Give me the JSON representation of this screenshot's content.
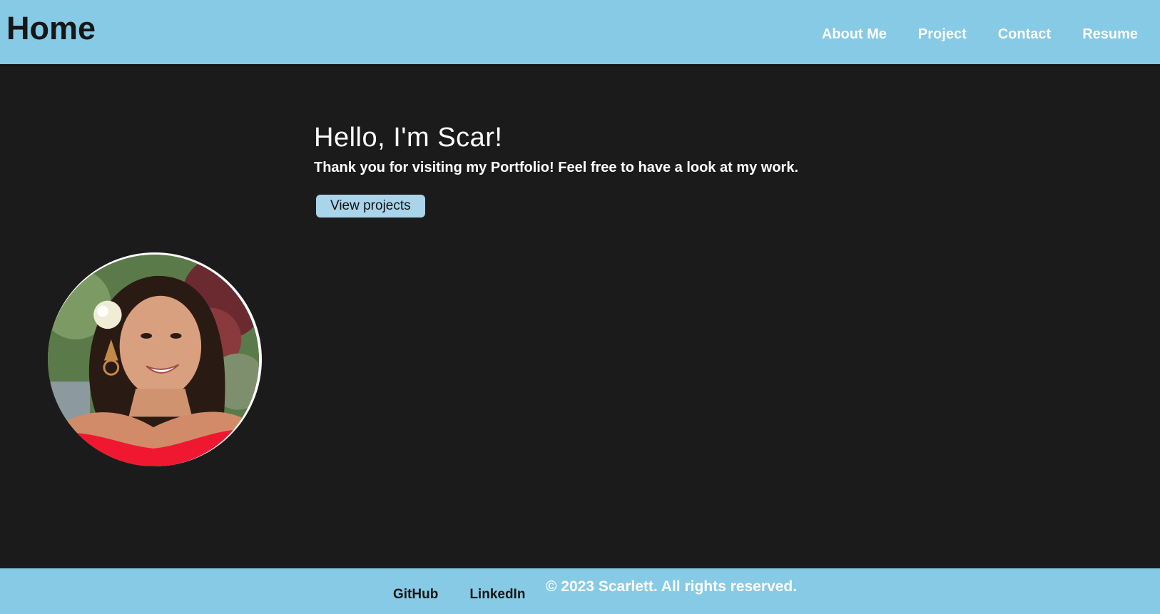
{
  "header": {
    "title": "Home",
    "nav": [
      {
        "label": "About Me"
      },
      {
        "label": "Project"
      },
      {
        "label": "Contact"
      },
      {
        "label": "Resume"
      }
    ],
    "background_color": "#86cae6"
  },
  "hero": {
    "heading": "Hello, I'm Scar!",
    "subheading": "Thank you for visiting my Portfolio! Feel free to have a look at my work.",
    "button_label": "View projects"
  },
  "profile": {
    "photo_icon": "profile-photo"
  },
  "footer": {
    "links": [
      {
        "label": "GitHub"
      },
      {
        "label": "LinkedIn"
      }
    ],
    "copyright": "© 2023 Scarlett. All rights reserved."
  },
  "colors": {
    "page_background": "#1b1b1b",
    "accent": "#86cae6",
    "button": "#a9d4ea"
  }
}
